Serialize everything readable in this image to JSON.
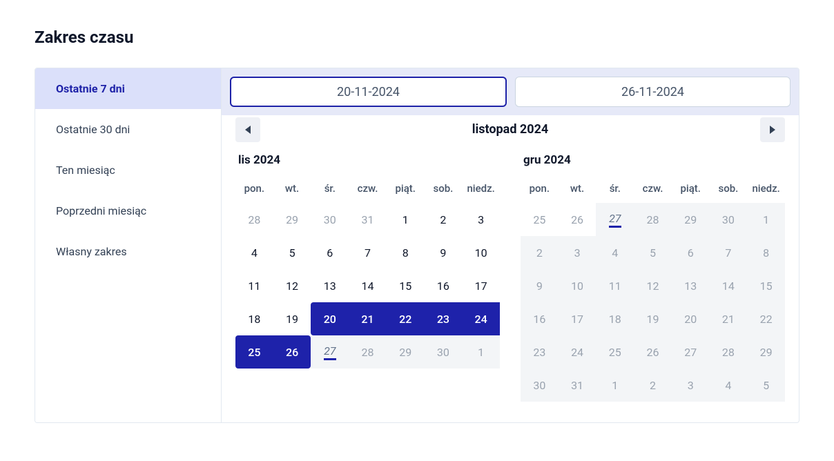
{
  "title": "Zakres czasu",
  "presets": [
    {
      "label": "Ostatnie 7 dni",
      "active": true
    },
    {
      "label": "Ostatnie 30 dni",
      "active": false
    },
    {
      "label": "Ten miesiąc",
      "active": false
    },
    {
      "label": "Poprzedni miesiąc",
      "active": false
    },
    {
      "label": "Własny zakres",
      "active": false
    }
  ],
  "inputs": {
    "from": "20-11-2024",
    "to": "26-11-2024"
  },
  "nav_label": "listopad 2024",
  "dow": [
    "pon.",
    "wt.",
    "śr.",
    "czw.",
    "piąt.",
    "sob.",
    "niedz."
  ],
  "months": [
    {
      "label": "lis 2024",
      "days": [
        {
          "n": 28,
          "cls": "dim"
        },
        {
          "n": 29,
          "cls": "dim"
        },
        {
          "n": 30,
          "cls": "dim"
        },
        {
          "n": 31,
          "cls": "dim"
        },
        {
          "n": 1,
          "cls": ""
        },
        {
          "n": 2,
          "cls": ""
        },
        {
          "n": 3,
          "cls": ""
        },
        {
          "n": 4,
          "cls": ""
        },
        {
          "n": 5,
          "cls": ""
        },
        {
          "n": 6,
          "cls": ""
        },
        {
          "n": 7,
          "cls": ""
        },
        {
          "n": 8,
          "cls": ""
        },
        {
          "n": 9,
          "cls": ""
        },
        {
          "n": 10,
          "cls": ""
        },
        {
          "n": 11,
          "cls": ""
        },
        {
          "n": 12,
          "cls": ""
        },
        {
          "n": 13,
          "cls": ""
        },
        {
          "n": 14,
          "cls": ""
        },
        {
          "n": 15,
          "cls": ""
        },
        {
          "n": 16,
          "cls": ""
        },
        {
          "n": 17,
          "cls": ""
        },
        {
          "n": 18,
          "cls": ""
        },
        {
          "n": 19,
          "cls": ""
        },
        {
          "n": 20,
          "cls": "in-range range-start"
        },
        {
          "n": 21,
          "cls": "in-range"
        },
        {
          "n": 22,
          "cls": "in-range"
        },
        {
          "n": 23,
          "cls": "in-range"
        },
        {
          "n": 24,
          "cls": "in-range"
        },
        {
          "n": 25,
          "cls": "in-range range-start"
        },
        {
          "n": 26,
          "cls": "in-range range-end"
        },
        {
          "n": 27,
          "cls": "disabled today"
        },
        {
          "n": 28,
          "cls": "disabled"
        },
        {
          "n": 29,
          "cls": "disabled"
        },
        {
          "n": 30,
          "cls": "disabled"
        },
        {
          "n": 1,
          "cls": "disabled"
        }
      ]
    },
    {
      "label": "gru 2024",
      "days": [
        {
          "n": 25,
          "cls": "dim"
        },
        {
          "n": 26,
          "cls": "dim"
        },
        {
          "n": 27,
          "cls": "disabled today"
        },
        {
          "n": 28,
          "cls": "disabled"
        },
        {
          "n": 29,
          "cls": "disabled"
        },
        {
          "n": 30,
          "cls": "disabled"
        },
        {
          "n": 1,
          "cls": "disabled"
        },
        {
          "n": 2,
          "cls": "disabled"
        },
        {
          "n": 3,
          "cls": "disabled"
        },
        {
          "n": 4,
          "cls": "disabled"
        },
        {
          "n": 5,
          "cls": "disabled"
        },
        {
          "n": 6,
          "cls": "disabled"
        },
        {
          "n": 7,
          "cls": "disabled"
        },
        {
          "n": 8,
          "cls": "disabled"
        },
        {
          "n": 9,
          "cls": "disabled"
        },
        {
          "n": 10,
          "cls": "disabled"
        },
        {
          "n": 11,
          "cls": "disabled"
        },
        {
          "n": 12,
          "cls": "disabled"
        },
        {
          "n": 13,
          "cls": "disabled"
        },
        {
          "n": 14,
          "cls": "disabled"
        },
        {
          "n": 15,
          "cls": "disabled"
        },
        {
          "n": 16,
          "cls": "disabled"
        },
        {
          "n": 17,
          "cls": "disabled"
        },
        {
          "n": 18,
          "cls": "disabled"
        },
        {
          "n": 19,
          "cls": "disabled"
        },
        {
          "n": 20,
          "cls": "disabled"
        },
        {
          "n": 21,
          "cls": "disabled"
        },
        {
          "n": 22,
          "cls": "disabled"
        },
        {
          "n": 23,
          "cls": "disabled"
        },
        {
          "n": 24,
          "cls": "disabled"
        },
        {
          "n": 25,
          "cls": "disabled"
        },
        {
          "n": 26,
          "cls": "disabled"
        },
        {
          "n": 27,
          "cls": "disabled"
        },
        {
          "n": 28,
          "cls": "disabled"
        },
        {
          "n": 29,
          "cls": "disabled"
        },
        {
          "n": 30,
          "cls": "disabled"
        },
        {
          "n": 31,
          "cls": "disabled"
        },
        {
          "n": 1,
          "cls": "disabled"
        },
        {
          "n": 2,
          "cls": "disabled"
        },
        {
          "n": 3,
          "cls": "disabled"
        },
        {
          "n": 4,
          "cls": "disabled"
        },
        {
          "n": 5,
          "cls": "disabled"
        }
      ]
    }
  ]
}
